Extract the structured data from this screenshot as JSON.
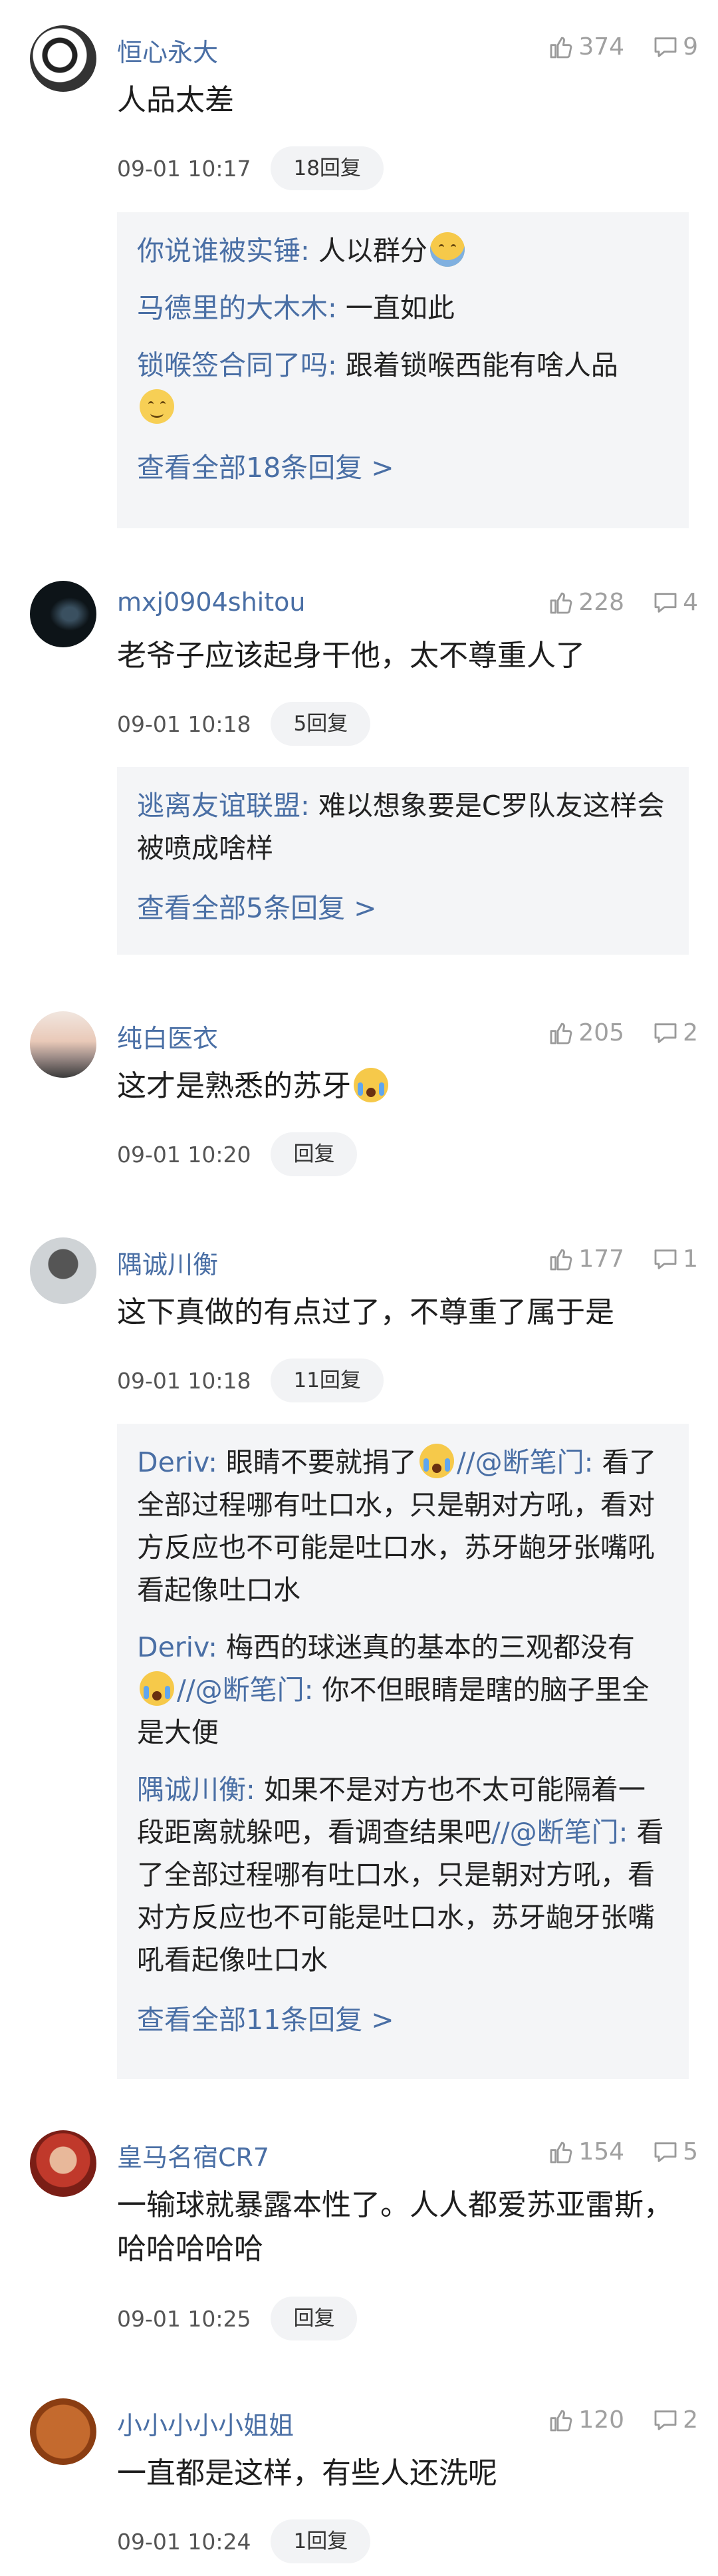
{
  "comments": [
    {
      "username": "恒心永大",
      "likes": "374",
      "reply_count": "9",
      "text": "人品太差",
      "time": "09-01 10:17",
      "reply_button": "18回复",
      "replies": [
        {
          "name": "你说谁被实锤:",
          "text": "人以群分"
        },
        {
          "name": "马德里的大木木:",
          "text": "一直如此"
        },
        {
          "name": "锁喉签合同了吗:",
          "text": "跟着锁喉西能有啥人品"
        }
      ],
      "view_all": "查看全部18条回复 >"
    },
    {
      "username": "mxj0904shitou",
      "likes": "228",
      "reply_count": "4",
      "text": "老爷子应该起身干他，太不尊重人了",
      "time": "09-01 10:18",
      "reply_button": "5回复",
      "replies": [
        {
          "name": "逃离友谊联盟:",
          "text": "难以想象要是C罗队友这样会被喷成啥样"
        }
      ],
      "view_all": "查看全部5条回复 >"
    },
    {
      "username": "纯白医衣",
      "likes": "205",
      "reply_count": "2",
      "text": "这才是熟悉的苏牙",
      "time": "09-01 10:20",
      "reply_button": "回复"
    },
    {
      "username": "隅诚川衡",
      "likes": "177",
      "reply_count": "1",
      "text": "这下真做的有点过了，不尊重了属于是",
      "time": "09-01 10:18",
      "reply_button": "11回复",
      "replies": [
        {
          "name": "Deriv:",
          "text_a": "眼睛不要就捐了",
          "mention": "//@断笔门:",
          "text_b": "看了全部过程哪有吐口水，只是朝对方吼，看对方反应也不可能是吐口水，苏牙龅牙张嘴吼看起像吐口水"
        },
        {
          "name": "Deriv:",
          "text_a": "梅西的球迷真的基本的三观都没有",
          "mention": "//@断笔门:",
          "text_b": "你不但眼睛是瞎的脑子里全是大便"
        },
        {
          "name": "隅诚川衡:",
          "text_a": "如果不是对方也不太可能隔着一段距离就躲吧，看调查结果吧",
          "mention": "//@断笔门:",
          "text_b": "看了全部过程哪有吐口水，只是朝对方吼，看对方反应也不可能是吐口水，苏牙龅牙张嘴吼看起像吐口水"
        }
      ],
      "view_all": "查看全部11条回复 >"
    },
    {
      "username": "皇马名宿CR7",
      "likes": "154",
      "reply_count": "5",
      "text": "一输球就暴露本性了。人人都爱苏亚雷斯，哈哈哈哈哈",
      "time": "09-01 10:25",
      "reply_button": "回复"
    },
    {
      "username": "小小小小小姐姐",
      "likes": "120",
      "reply_count": "2",
      "text": "一直都是这样，有些人还洗呢",
      "time": "09-01 10:24",
      "reply_button": "1回复"
    }
  ],
  "icons": {
    "like": "thumbs-up-icon",
    "reply": "comment-bubble-icon"
  },
  "colors": {
    "username": "#4a6fa5",
    "meta": "#a0a0a0",
    "reply_bg": "#f4f5f7"
  }
}
